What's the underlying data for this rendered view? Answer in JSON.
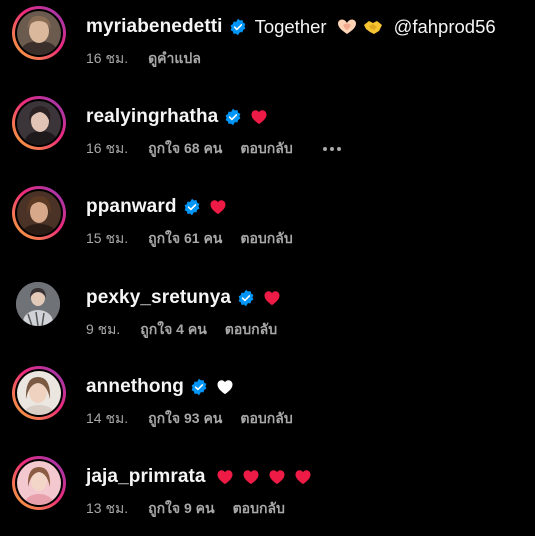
{
  "colors": {
    "background": "#000000",
    "text": "#f5f5f5",
    "meta": "#a8a8a8",
    "verified": "#0095f6",
    "heart_red": "#ed1b45",
    "heart_white": "#ffffff"
  },
  "comments": [
    {
      "username": "myriabenedetti",
      "verified": true,
      "text": "Together",
      "emojis": [
        "heart-hands-emoji",
        "handshake-emoji"
      ],
      "mention": "@fahprod56",
      "time": "16 ชม.",
      "translate": "ดูคำแปล"
    },
    {
      "username": "realyingrhatha",
      "verified": true,
      "hearts": [
        "red"
      ],
      "time": "16 ชม.",
      "likes": "ถูกใจ 68 คน",
      "reply": "ตอบกลับ",
      "more_icon": "more-options-icon"
    },
    {
      "username": "ppanward",
      "verified": true,
      "hearts": [
        "red"
      ],
      "time": "15 ชม.",
      "likes": "ถูกใจ 61 คน",
      "reply": "ตอบกลับ"
    },
    {
      "username": "pexky_sretunya",
      "verified": true,
      "hearts": [
        "red"
      ],
      "time": "9 ชม.",
      "likes": "ถูกใจ 4 คน",
      "reply": "ตอบกลับ"
    },
    {
      "username": "annethong",
      "verified": true,
      "hearts": [
        "white"
      ],
      "time": "14 ชม.",
      "likes": "ถูกใจ 93 คน",
      "reply": "ตอบกลับ"
    },
    {
      "username": "jaja_primrata",
      "verified": false,
      "hearts": [
        "red",
        "red",
        "red",
        "red"
      ],
      "time": "13 ชม.",
      "likes": "ถูกใจ 9 คน",
      "reply": "ตอบกลับ"
    }
  ]
}
